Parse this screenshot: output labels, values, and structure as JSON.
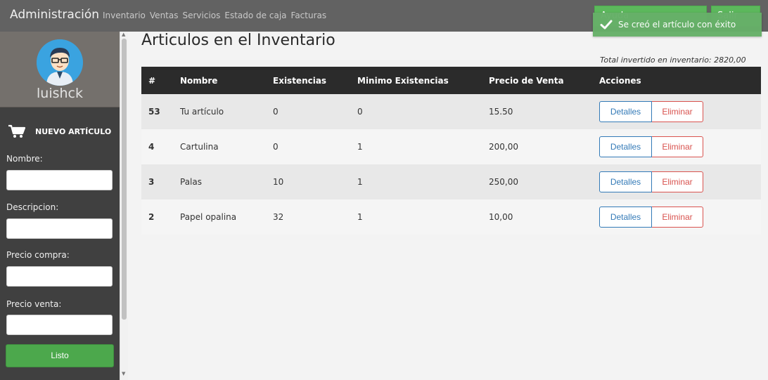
{
  "navbar": {
    "brand": "Administración",
    "links": [
      "Inventario",
      "Ventas",
      "Servicios",
      "Estado de caja",
      "Facturas"
    ],
    "help_label": "Ayuda",
    "exit_label": "Salir"
  },
  "toast": {
    "icon": "check-icon",
    "message": "Se creó el artículo con éxito"
  },
  "sidebar": {
    "username": "luishck",
    "new_item_title": "NUEVO ARTÍCULO",
    "fields": {
      "name_label": "Nombre:",
      "description_label": "Descripcion:",
      "buy_price_label": "Precio compra:",
      "sell_price_label": "Precio venta:"
    },
    "done_label": "Listo"
  },
  "main": {
    "title": "Articulos en el Inventario",
    "total_text": "Total invertido en inventario: 2820,00",
    "table": {
      "headers": [
        "#",
        "Nombre",
        "Existencias",
        "Minimo Existencias",
        "Precio de Venta",
        "Acciones"
      ],
      "rows": [
        {
          "id": "53",
          "name": "Tu artículo",
          "stock": "0",
          "min_stock": "0",
          "price": "15.50"
        },
        {
          "id": "4",
          "name": "Cartulina",
          "stock": "0",
          "min_stock": "1",
          "price": "200,00"
        },
        {
          "id": "3",
          "name": "Palas",
          "stock": "10",
          "min_stock": "1",
          "price": "250,00"
        },
        {
          "id": "2",
          "name": "Papel opalina",
          "stock": "32",
          "min_stock": "1",
          "price": "10,00"
        }
      ],
      "detail_label": "Detalles",
      "delete_label": "Eliminar"
    }
  },
  "colors": {
    "navbar": "#626262",
    "sidebar": "#404040",
    "success": "#5cb85c",
    "primary": "#337ab7",
    "danger": "#d9534f"
  }
}
